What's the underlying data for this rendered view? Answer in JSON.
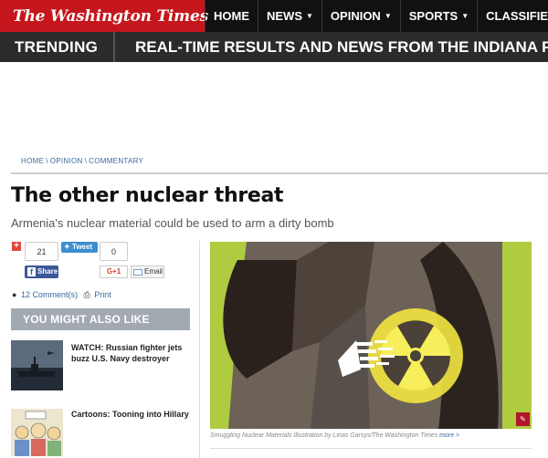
{
  "header": {
    "logo": "The Washington Times",
    "nav": [
      {
        "label": "HOME",
        "dropdown": false
      },
      {
        "label": "NEWS",
        "dropdown": true
      },
      {
        "label": "OPINION",
        "dropdown": true
      },
      {
        "label": "SPORTS",
        "dropdown": true
      },
      {
        "label": "CLASSIFIEDS",
        "dropdown": false
      }
    ],
    "colors": {
      "brand_red": "#c5161d",
      "nav_bg": "#111111"
    }
  },
  "trending": {
    "label": "TRENDING",
    "story": "REAL-TIME RESULTS AND NEWS FROM THE INDIANA PRI"
  },
  "breadcrumb": [
    "HOME",
    "OPINION",
    "COMMENTARY"
  ],
  "article": {
    "headline": "The other nuclear threat",
    "deck": "Armenia's nuclear material could be used to arm a dirty bomb",
    "image_caption": "Smuggling Nuclear Materials Illustration by Linas Garsys/The Washington Times",
    "caption_more": "more >"
  },
  "share": {
    "facebook_count": "21",
    "facebook_label": "Share",
    "tweet_label": "Tweet",
    "tweet_count": "0",
    "gplus_label": "G+1",
    "email_label": "Email",
    "comments_count": "12",
    "comments_label": "Comment(s)",
    "print_label": "Print"
  },
  "related": {
    "heading": "YOU MIGHT ALSO LIKE",
    "items": [
      {
        "title": "WATCH: Russian fighter jets buzz U.S. Navy destroyer"
      },
      {
        "title": "Cartoons: Tooning into Hillary"
      }
    ]
  },
  "icons": [
    "plus-icon",
    "facebook-icon",
    "twitter-bird-icon",
    "envelope-icon",
    "comment-icon",
    "print-icon",
    "pin-icon",
    "caret-down-icon"
  ]
}
